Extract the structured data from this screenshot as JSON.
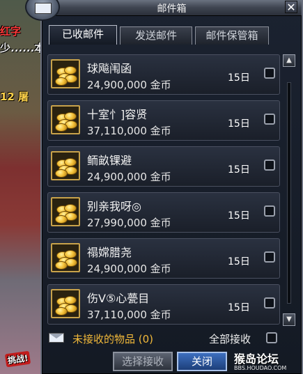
{
  "scene": {
    "text_red": "红字",
    "text_white": "少......本",
    "text_yellow": "12 屠",
    "battle_badge": "挑战!"
  },
  "window": {
    "title": "邮件箱",
    "close_symbol": "✕"
  },
  "tabs": [
    {
      "label": "已收邮件",
      "active": true
    },
    {
      "label": "发送邮件",
      "active": false
    },
    {
      "label": "邮件保管箱",
      "active": false
    }
  ],
  "mails": [
    {
      "sender": "球飚闱函",
      "amount": "24,900,000 金币",
      "days": "15日",
      "checked": false
    },
    {
      "sender": "十室忄]容贤",
      "amount": "37,110,000 金币",
      "days": "15日",
      "checked": false
    },
    {
      "sender": "鲕畝锞避",
      "amount": "24,900,000 金币",
      "days": "15日",
      "checked": false
    },
    {
      "sender": "别亲我呀◎",
      "amount": "27,990,000 金币",
      "days": "15日",
      "checked": false
    },
    {
      "sender": "禢嫦腊尧",
      "amount": "24,900,000 金币",
      "days": "15日",
      "checked": false
    },
    {
      "sender": "伤V⑤心甍目",
      "amount": "37,110,000 金币",
      "days": "15日",
      "checked": false
    }
  ],
  "scrollbar": {
    "up": "▲",
    "down": "▼"
  },
  "footer": {
    "unread_label": "未接收的物品 (0)",
    "receive_all_label": "全部接收",
    "select_receive_button": "选择接收",
    "close_button": "关闭"
  },
  "watermark": {
    "main": "猴岛论坛",
    "sub": "BBS.HOUDAO.COM"
  },
  "colors": {
    "accent_gold": "#f2b93a",
    "active_button": "#2a56a4",
    "panel_bg": "#1a1f29"
  }
}
